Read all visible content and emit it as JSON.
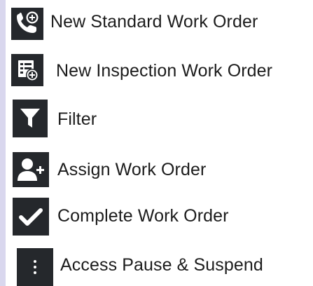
{
  "legend": {
    "items": [
      {
        "icon": "phone-plus-icon",
        "label": "New Standard Work Order"
      },
      {
        "icon": "inspection-form-plus-icon",
        "label": "New Inspection Work Order"
      },
      {
        "icon": "filter-funnel-icon",
        "label": "Filter"
      },
      {
        "icon": "user-plus-icon",
        "label": "Assign Work Order"
      },
      {
        "icon": "check-icon",
        "label": "Complete Work Order"
      },
      {
        "icon": "vertical-dots-icon",
        "label": "Access Pause & Suspend"
      }
    ],
    "colors": {
      "icon_background": "#25282c",
      "icon_foreground": "#ffffff",
      "text": "#1c1c1c",
      "side_bar": "#d9d7ee"
    }
  }
}
